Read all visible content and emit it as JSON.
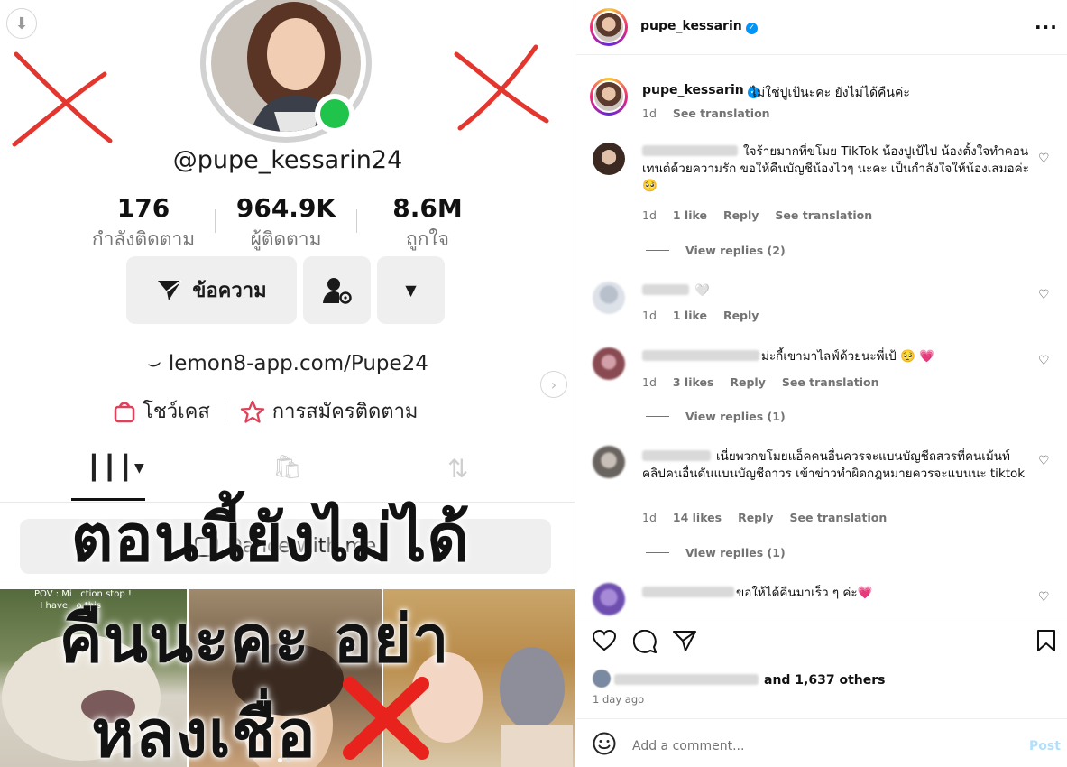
{
  "tiktok": {
    "handle": "@pupe_kessarin24",
    "stats": [
      {
        "value": "176",
        "label": "กำลังติดตาม"
      },
      {
        "value": "964.9K",
        "label": "ผู้ติดตาม"
      },
      {
        "value": "8.6M",
        "label": "ถูกใจ"
      }
    ],
    "message_button": "ข้อความ",
    "bio_link": "lemon8-app.com/Pupe24",
    "showcase_label": "โชว์เคส",
    "subscribe_label": "การสมัครติดตาม",
    "playlist_label": "Dance with me",
    "video_caption": "POV : Mi   ction stop !\n  I have   o this",
    "overlay_lines": [
      "ตอนนี้ยังไม่ได้",
      "คืนนะคะ อย่า",
      "หลงเชื่อ"
    ]
  },
  "instagram": {
    "username": "pupe_kessarin",
    "caption": "ไม่ใช่ปูเป้นะคะ ยังไม่ได้คืนค่ะ",
    "caption_time": "1d",
    "see_translation": "See translation",
    "comments": [
      {
        "text": "ใจร้ายมากที่ขโมย TikTok น้องปูเป้ไป น้องตั้งใจทำคอนเทนต์ด้วยความรัก ขอให้คืนบัญชีน้องไวๆ นะคะ เป็นกำลังใจให้น้องเสมอค่ะ 🥺",
        "time": "1d",
        "likes": "1 like",
        "reply": "Reply",
        "translate": "See translation",
        "view_replies": "View replies (2)"
      },
      {
        "text": "🤍",
        "time": "1d",
        "likes": "1 like",
        "reply": "Reply",
        "translate": "",
        "view_replies": ""
      },
      {
        "text": "ม่ะกี้เขามาไลฟ์ด้วยนะพี่เป้ 🥺 💗",
        "time": "1d",
        "likes": "3 likes",
        "reply": "Reply",
        "translate": "See translation",
        "view_replies": "View replies (1)"
      },
      {
        "text": "เนี่ยพวกขโมยแอ็คคนอื่นควรจะแบนบัญชีถสวรที่คนเม้นท์คลิปคนอื่นดันแบนบัญชีถาวร เข้าข่าวทำผิดกฎหมายควรจะแบนนะ tiktok",
        "time": "1d",
        "likes": "14 likes",
        "reply": "Reply",
        "translate": "See translation",
        "view_replies": "View replies (1)"
      },
      {
        "text": "ขอให้ได้คืนมาเร็ว ๆ ค่ะ💗",
        "time": "",
        "likes": "",
        "reply": "",
        "translate": "",
        "view_replies": ""
      }
    ],
    "likes_text": "and 1,637 others",
    "time_ago": "1 day ago",
    "add_comment_placeholder": "Add a comment...",
    "post_label": "Post",
    "colors": {
      "verified": "#0095f6",
      "post_disabled": "#b2dffc",
      "online": "#21c44a",
      "red_x": "#e3362e"
    }
  }
}
